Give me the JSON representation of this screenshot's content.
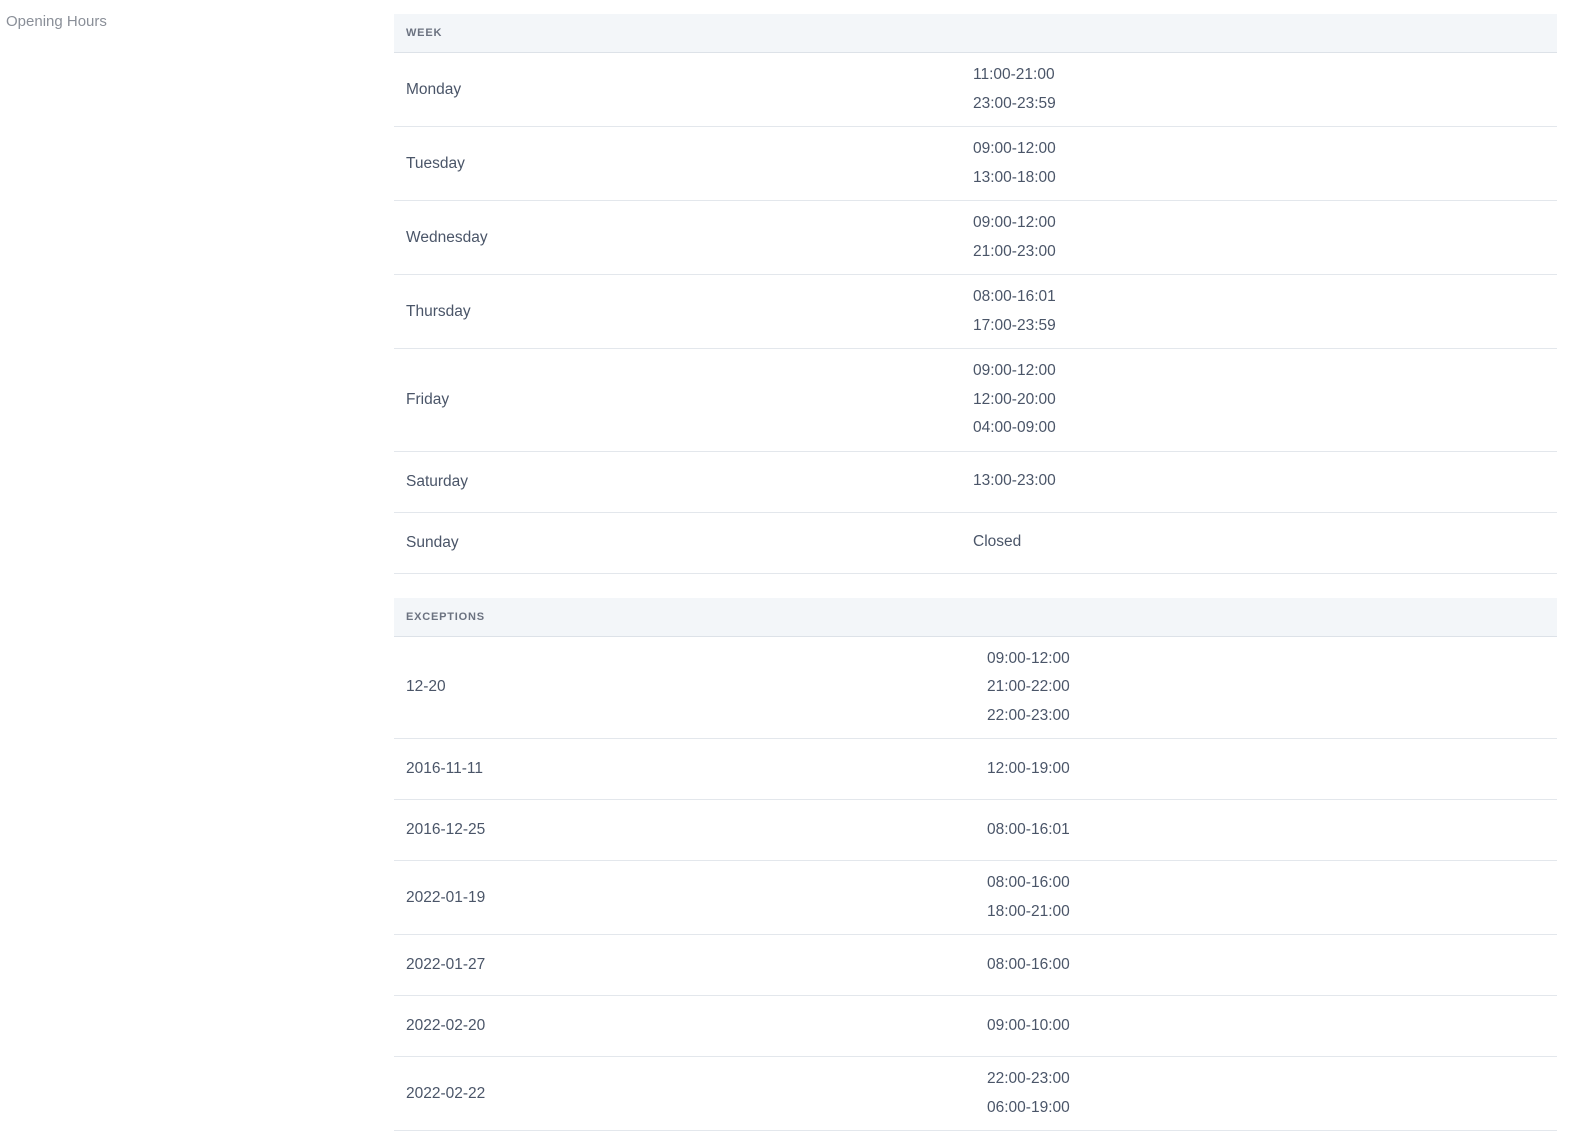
{
  "field_label": "Opening Hours",
  "week": {
    "header": "WEEK",
    "rows": [
      {
        "day": "Monday",
        "slots": [
          "11:00-21:00",
          "23:00-23:59"
        ]
      },
      {
        "day": "Tuesday",
        "slots": [
          "09:00-12:00",
          "13:00-18:00"
        ]
      },
      {
        "day": "Wednesday",
        "slots": [
          "09:00-12:00",
          "21:00-23:00"
        ]
      },
      {
        "day": "Thursday",
        "slots": [
          "08:00-16:01",
          "17:00-23:59"
        ]
      },
      {
        "day": "Friday",
        "slots": [
          "09:00-12:00",
          "12:00-20:00",
          "04:00-09:00"
        ]
      },
      {
        "day": "Saturday",
        "slots": [
          "13:00-23:00"
        ]
      },
      {
        "day": "Sunday",
        "slots": [
          "Closed"
        ]
      }
    ]
  },
  "exceptions": {
    "header": "EXCEPTIONS",
    "rows": [
      {
        "day": "12-20",
        "slots": [
          "09:00-12:00",
          "21:00-22:00",
          "22:00-23:00"
        ]
      },
      {
        "day": "2016-11-11",
        "slots": [
          "12:00-19:00"
        ]
      },
      {
        "day": "2016-12-25",
        "slots": [
          "08:00-16:01"
        ]
      },
      {
        "day": "2022-01-19",
        "slots": [
          "08:00-16:00",
          "18:00-21:00"
        ]
      },
      {
        "day": "2022-01-27",
        "slots": [
          "08:00-16:00"
        ]
      },
      {
        "day": "2022-02-20",
        "slots": [
          "09:00-10:00"
        ]
      },
      {
        "day": "2022-02-22",
        "slots": [
          "22:00-23:00",
          "06:00-19:00"
        ]
      }
    ]
  }
}
